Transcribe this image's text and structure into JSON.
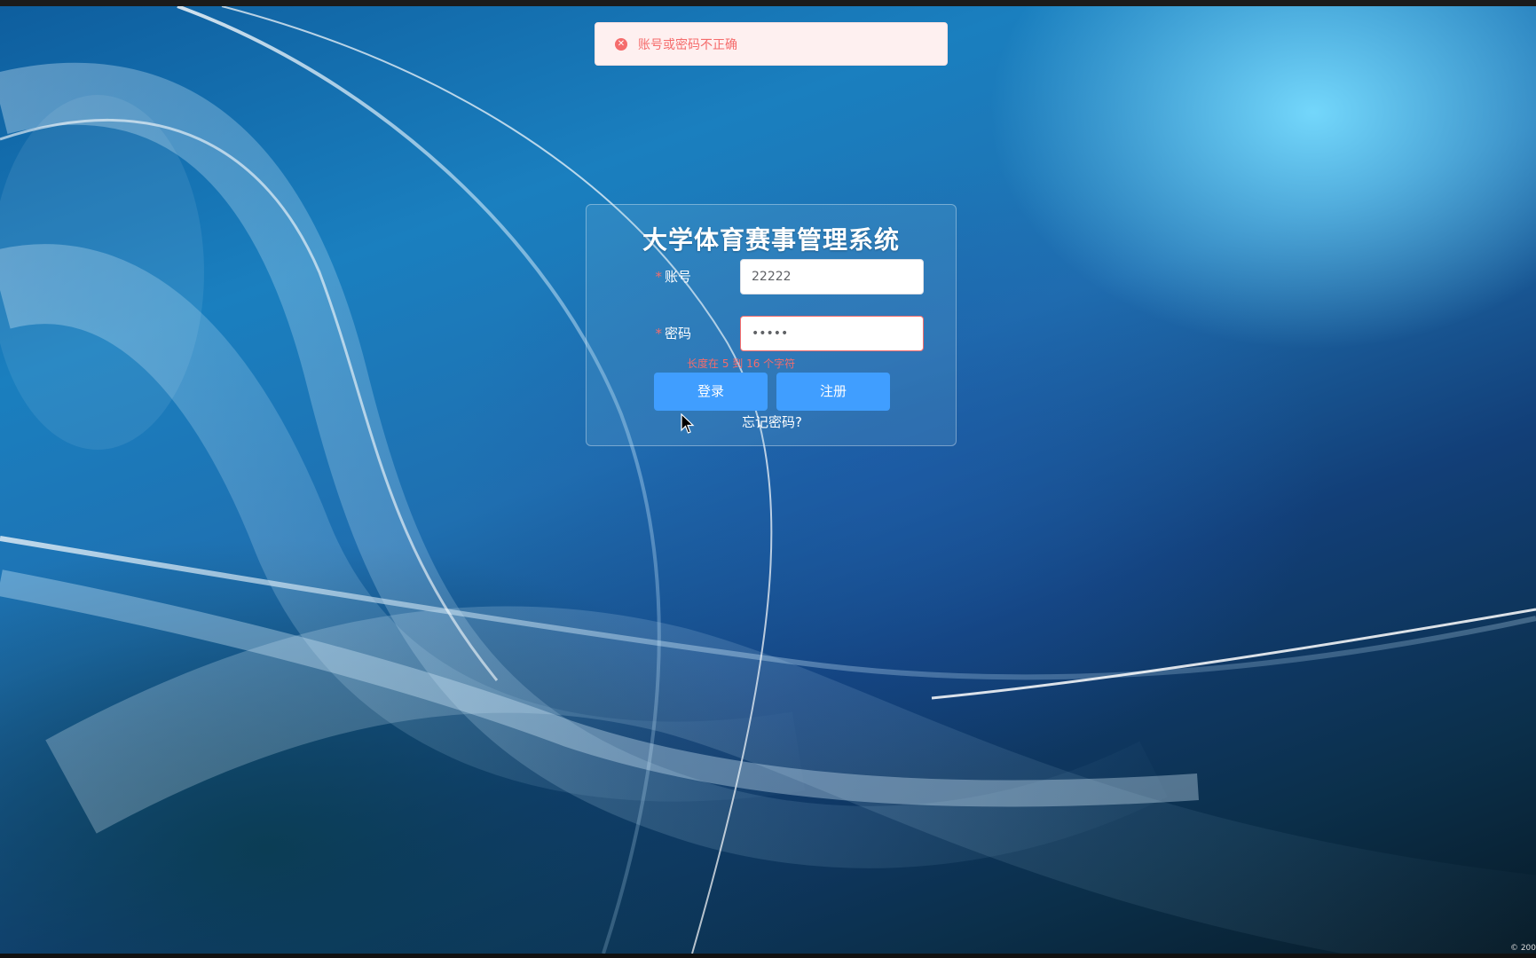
{
  "toast": {
    "type": "error",
    "icon": "close-circle-icon",
    "message": "账号或密码不正确"
  },
  "login": {
    "title": "大学体育赛事管理系统",
    "username": {
      "label": "账号",
      "value": "22222"
    },
    "password": {
      "label": "密码",
      "value": "•••••",
      "error": "长度在 5 到 16 个字符"
    },
    "buttons": {
      "login": "登录",
      "register": "注册"
    },
    "forgot": "忘记密码?"
  },
  "footer": {
    "copyright": "© 200"
  },
  "colors": {
    "primary": "#409eff",
    "error": "#f56c6c",
    "toast_bg": "#fef0f0"
  }
}
